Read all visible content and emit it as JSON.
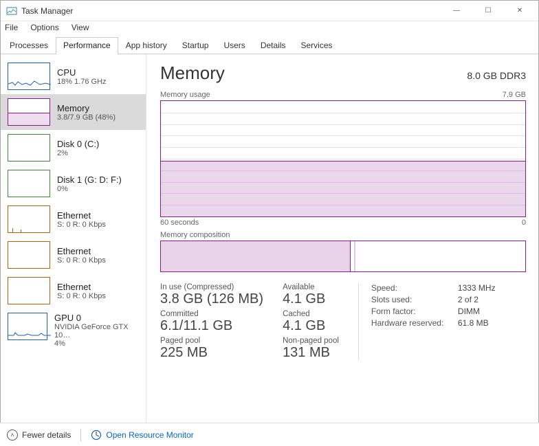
{
  "window": {
    "title": "Task Manager"
  },
  "menu": {
    "file": "File",
    "options": "Options",
    "view": "View"
  },
  "tabs": {
    "processes": "Processes",
    "performance": "Performance",
    "app_history": "App history",
    "startup": "Startup",
    "users": "Users",
    "details": "Details",
    "services": "Services"
  },
  "sidebar": [
    {
      "title": "CPU",
      "sub": "18% 1.76 GHz"
    },
    {
      "title": "Memory",
      "sub": "3.8/7.9 GB (48%)"
    },
    {
      "title": "Disk 0 (C:)",
      "sub": "2%"
    },
    {
      "title": "Disk 1 (G: D: F:)",
      "sub": "0%"
    },
    {
      "title": "Ethernet",
      "sub": "S: 0 R: 0 Kbps"
    },
    {
      "title": "Ethernet",
      "sub": "S: 0 R: 0 Kbps"
    },
    {
      "title": "Ethernet",
      "sub": "S: 0 R: 0 Kbps"
    },
    {
      "title": "GPU 0",
      "sub": "NVIDIA GeForce GTX 10…",
      "sub2": "4%"
    }
  ],
  "main": {
    "heading": "Memory",
    "spec": "8.0 GB DDR3",
    "usage_label_left": "Memory usage",
    "usage_label_right": "7.9 GB",
    "axis_left": "60 seconds",
    "axis_right": "0",
    "comp_label": "Memory composition",
    "stats": {
      "inuse_label": "In use (Compressed)",
      "inuse_val": "3.8 GB (126 MB)",
      "avail_label": "Available",
      "avail_val": "4.1 GB",
      "committed_label": "Committed",
      "committed_val": "6.1/11.1 GB",
      "cached_label": "Cached",
      "cached_val": "4.1 GB",
      "paged_label": "Paged pool",
      "paged_val": "225 MB",
      "nonpaged_label": "Non-paged pool",
      "nonpaged_val": "131 MB"
    },
    "right": {
      "speed_k": "Speed:",
      "speed_v": "1333 MHz",
      "slots_k": "Slots used:",
      "slots_v": "2 of 2",
      "form_k": "Form factor:",
      "form_v": "DIMM",
      "hw_k": "Hardware reserved:",
      "hw_v": "61.8 MB"
    }
  },
  "footer": {
    "fewer": "Fewer details",
    "orm": "Open Resource Monitor"
  },
  "chart_data": {
    "type": "area",
    "title": "Memory usage",
    "x": [
      "60 seconds",
      "0"
    ],
    "ylim": [
      0,
      7.9
    ],
    "series": [
      {
        "name": "In use",
        "values_approx_gb": 3.8,
        "percent": 48
      }
    ],
    "composition_percent": {
      "in_use": 48,
      "modified": 2,
      "standby": 50
    }
  }
}
